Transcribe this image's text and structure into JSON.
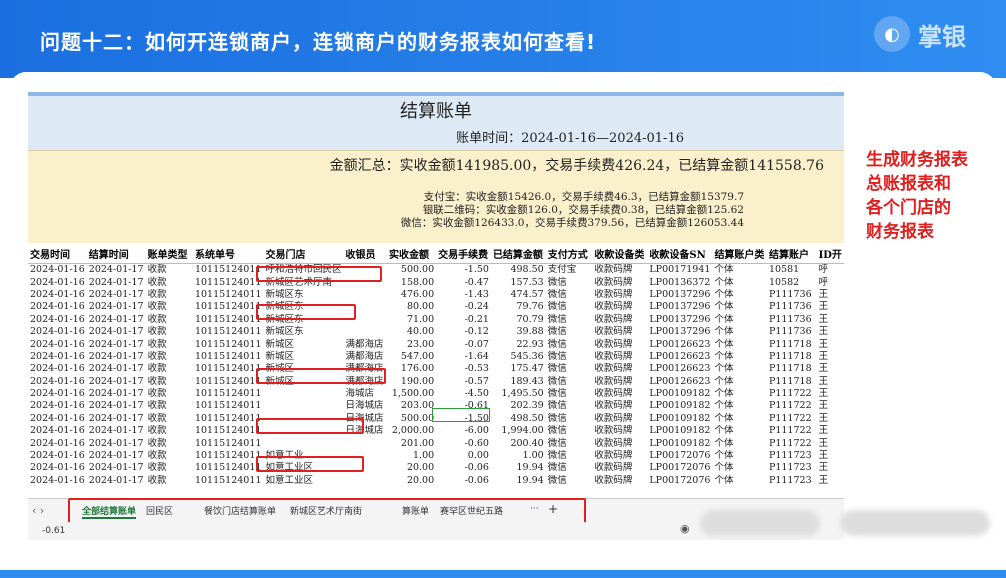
{
  "header": {
    "title": "问题十二：如何开连锁商户，连锁商户的财务报表如何查看!",
    "logo_text": "掌银"
  },
  "sheet": {
    "title": "结算账单",
    "date_line": "账单时间：2024-01-16—2024-01-16",
    "summary_line": "金额汇总：实收金额141985.00，交易手续费426.24，已结算金额141558.76",
    "pay_lines": [
      "支付宝：实收金额15426.0，交易手续费46.3，已结算金额15379.7",
      "银联二维码：实收金额126.0，交易手续费0.38，已结算金额125.62",
      "微信：实收金额126433.0，交易手续费379.56，已结算金额126053.44"
    ],
    "columns": [
      "交易时间",
      "结算时间",
      "账单类型",
      "系统单号",
      "交易门店",
      "收银员",
      "实收金额",
      "交易手续费",
      "已结算金额",
      "支付方式",
      "收款设备类",
      "收款设备SN",
      "结算账户类",
      "结算账户",
      "ID开"
    ],
    "rows": [
      [
        "2024-01-16",
        "2024-01-17",
        "收款",
        "10115124011",
        "呼和浩特市回民区",
        "",
        "500.00",
        "-1.50",
        "498.50",
        "支付宝",
        "收款码牌",
        "LP00171941",
        "个体",
        "10581",
        "呼"
      ],
      [
        "2024-01-16",
        "2024-01-17",
        "收款",
        "10115124011",
        "新城区艺术厅南",
        "",
        "158.00",
        "-0.47",
        "157.53",
        "微信",
        "收款码牌",
        "LP00136372",
        "个体",
        "10582",
        "呼"
      ],
      [
        "2024-01-16",
        "2024-01-17",
        "收款",
        "10115124011",
        "新城区东",
        "",
        "476.00",
        "-1.43",
        "474.57",
        "微信",
        "收款码牌",
        "LP00137296",
        "个体",
        "P111736",
        "王"
      ],
      [
        "2024-01-16",
        "2024-01-17",
        "收款",
        "10115124011",
        "新城区东",
        "",
        "80.00",
        "-0.24",
        "79.76",
        "微信",
        "收款码牌",
        "LP00137296",
        "个体",
        "P111736",
        "王"
      ],
      [
        "2024-01-16",
        "2024-01-17",
        "收款",
        "10115124011",
        "新城区东",
        "",
        "71.00",
        "-0.21",
        "70.79",
        "微信",
        "收款码牌",
        "LP00137296",
        "个体",
        "P111736",
        "王"
      ],
      [
        "2024-01-16",
        "2024-01-17",
        "收款",
        "10115124011",
        "新城区东",
        "",
        "40.00",
        "-0.12",
        "39.88",
        "微信",
        "收款码牌",
        "LP00137296",
        "个体",
        "P111736",
        "王"
      ],
      [
        "2024-01-16",
        "2024-01-17",
        "收款",
        "10115124011",
        "新城区",
        "满都海店",
        "23.00",
        "-0.07",
        "22.93",
        "微信",
        "收款码牌",
        "LP00126623",
        "个体",
        "P111718",
        "王"
      ],
      [
        "2024-01-16",
        "2024-01-17",
        "收款",
        "10115124011",
        "新城区",
        "满都海店",
        "547.00",
        "-1.64",
        "545.36",
        "微信",
        "收款码牌",
        "LP00126623",
        "个体",
        "P111718",
        "王"
      ],
      [
        "2024-01-16",
        "2024-01-17",
        "收款",
        "10115124011",
        "新城区",
        "满都海店",
        "176.00",
        "-0.53",
        "175.47",
        "微信",
        "收款码牌",
        "LP00126623",
        "个体",
        "P111718",
        "王"
      ],
      [
        "2024-01-16",
        "2024-01-17",
        "收款",
        "10115124011",
        "新城区",
        "满都海店",
        "190.00",
        "-0.57",
        "189.43",
        "微信",
        "收款码牌",
        "LP00126623",
        "个体",
        "P111718",
        "王"
      ],
      [
        "2024-01-16",
        "2024-01-17",
        "收款",
        "10115124011",
        "",
        "海城店",
        "1,500.00",
        "-4.50",
        "1,495.50",
        "微信",
        "收款码牌",
        "LP00109182",
        "个体",
        "P111722",
        "王"
      ],
      [
        "2024-01-16",
        "2024-01-17",
        "收款",
        "10115124011",
        "",
        "日海城店",
        "203.00",
        "-0.61",
        "202.39",
        "微信",
        "收款码牌",
        "LP00109182",
        "个体",
        "P111722",
        "王"
      ],
      [
        "2024-01-16",
        "2024-01-17",
        "收款",
        "10115124011",
        "",
        "日海城店",
        "500.00",
        "-1.50",
        "498.50",
        "微信",
        "收款码牌",
        "LP00109182",
        "个体",
        "P111722",
        "王"
      ],
      [
        "2024-01-16",
        "2024-01-17",
        "收款",
        "10115124011",
        "",
        "日海城店",
        "2,000.00",
        "-6.00",
        "1,994.00",
        "微信",
        "收款码牌",
        "LP00109182",
        "个体",
        "P111722",
        "王"
      ],
      [
        "2024-01-16",
        "2024-01-17",
        "收款",
        "10115124011",
        "",
        "",
        "201.00",
        "-0.60",
        "200.40",
        "微信",
        "收款码牌",
        "LP00109182",
        "个体",
        "P111722",
        "王"
      ],
      [
        "2024-01-16",
        "2024-01-17",
        "收款",
        "10115124011",
        "如意工业",
        "",
        "1.00",
        "0.00",
        "1.00",
        "微信",
        "收款码牌",
        "LP00172076",
        "个体",
        "P111723",
        "王"
      ],
      [
        "2024-01-16",
        "2024-01-17",
        "收款",
        "10115124011",
        "如意工业区",
        "",
        "20.00",
        "-0.06",
        "19.94",
        "微信",
        "收款码牌",
        "LP00172076",
        "个体",
        "P111723",
        "王"
      ],
      [
        "2024-01-16",
        "2024-01-17",
        "收款",
        "10115124011",
        "如意工业区",
        "",
        "20.00",
        "-0.06",
        "19.94",
        "微信",
        "收款码牌",
        "LP00172076",
        "个体",
        "P111723",
        "王"
      ]
    ]
  },
  "tabs": {
    "nav": "‹ ›",
    "items": [
      "全部结算账单",
      "回民区",
      "餐饮门店结算账单",
      "新城区艺术厅南街",
      "算账单",
      "赛罕区世纪五路",
      "···",
      "+"
    ],
    "active_index": 0
  },
  "status": {
    "value": "-0.61"
  },
  "note": {
    "lines": [
      "生成财务报表",
      "总账报表和",
      "各个门店的",
      "财务报表"
    ]
  },
  "colors": {
    "accent": "#1b6fe0",
    "highlight_red": "#e02020",
    "note_red": "#e01e1e",
    "summary_bg": "#fbf0cc",
    "title_bg": "#dde9f5"
  }
}
